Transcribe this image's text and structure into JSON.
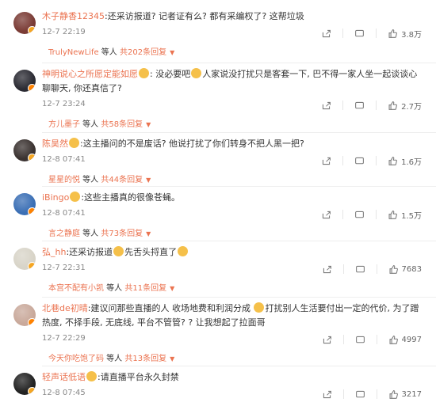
{
  "comments": [
    {
      "user": "木子静香12345",
      "parts": [
        {
          "t": "text",
          "v": ":还采访报道? 记者证有么? 都有采编权了? 这帮垃圾"
        }
      ],
      "time": "12-7 22:19",
      "likes": "3.8万",
      "reply": {
        "user": "TrulyNewLife",
        "mid": " 等人 ",
        "count": "共202条回复"
      },
      "avatar_color": "#7a3b35"
    },
    {
      "user": "神明说心之所愿定能如愿",
      "parts": [
        {
          "t": "emoji"
        },
        {
          "t": "text",
          "v": ": 没必要吧"
        },
        {
          "t": "emoji"
        },
        {
          "t": "text",
          "v": "人家说没打扰只是客套一下, 巴不得一家人坐一起谈谈心聊聊天, 你还真信了?"
        }
      ],
      "time": "12-7 23:24",
      "likes": "2.7万",
      "reply": {
        "user": "方儿墨子",
        "mid": " 等人 ",
        "count": "共58条回复"
      },
      "avatar_color": "#2b2b33"
    },
    {
      "user": "陈昊然",
      "parts": [
        {
          "t": "emoji"
        },
        {
          "t": "text",
          "v": ":这主播问的不是废话? 他说打扰了你们转身不把人黑一把?"
        }
      ],
      "time": "12-8 07:41",
      "likes": "1.6万",
      "reply": {
        "user": "星星的悦",
        "mid": " 等人 ",
        "count": "共44条回复"
      },
      "avatar_color": "#3a3230"
    },
    {
      "user": "iBingo",
      "parts": [
        {
          "t": "emoji"
        },
        {
          "t": "text",
          "v": ":这些主播真的很像苍蝇。"
        }
      ],
      "time": "12-8 07:41",
      "likes": "1.5万",
      "reply": {
        "user": "言之静庭",
        "mid": " 等人 ",
        "count": "共73条回复"
      },
      "avatar_color": "#3b6fb5"
    },
    {
      "user": "弘_hh",
      "parts": [
        {
          "t": "text",
          "v": ":还采访报道"
        },
        {
          "t": "emoji"
        },
        {
          "t": "text",
          "v": "先舌头捋直了"
        },
        {
          "t": "emoji"
        }
      ],
      "time": "12-7 22:31",
      "likes": "7683",
      "reply": {
        "user": "本宫不配有小凯",
        "mid": " 等人 ",
        "count": "共11条回复"
      },
      "avatar_color": "#d8d4c8"
    },
    {
      "user": "北巷de初晴",
      "parts": [
        {
          "t": "text",
          "v": ":建议问那些直播的人 收场地费和利润分成 "
        },
        {
          "t": "emoji"
        },
        {
          "t": "text",
          "v": "打扰别人生活要付出一定的代价, 为了蹭热度, 不择手段, 无底线, 平台不管管? ? 让我想起了拉面哥"
        }
      ],
      "time": "12-7 22:29",
      "likes": "4997",
      "reply": {
        "user": "今天你吃饱了码",
        "mid": " 等人 ",
        "count": "共13条回复"
      },
      "avatar_color": "#c9a99b"
    },
    {
      "user": "轻声话低语",
      "parts": [
        {
          "t": "emoji"
        },
        {
          "t": "text",
          "v": ":请直播平台永久封禁"
        }
      ],
      "time": "12-8 07:45",
      "likes": "3217",
      "reply": null,
      "avatar_color": "#222222"
    }
  ]
}
